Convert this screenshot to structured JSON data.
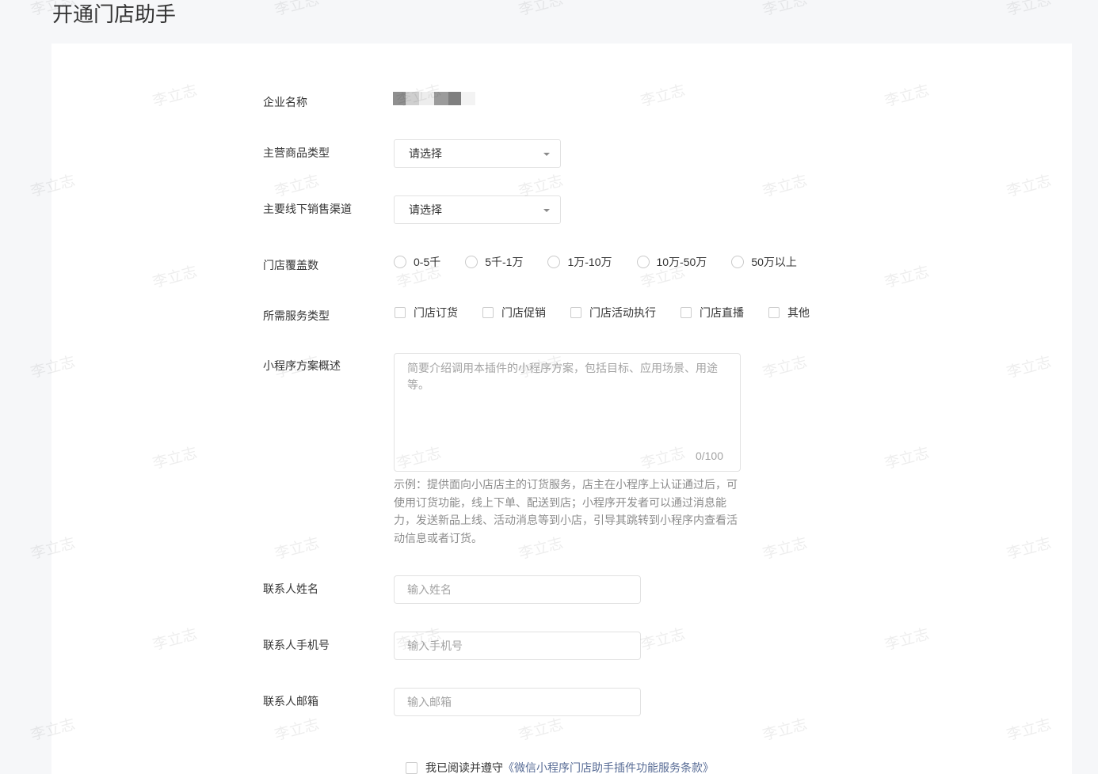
{
  "page": {
    "title": "开通门店助手"
  },
  "watermark": {
    "text": "李立志"
  },
  "icons": {
    "select_caret": "caret-down-icon"
  },
  "colors": {
    "page_background": "#f6f7f9",
    "card_background": "#ffffff",
    "text": "#353535",
    "link": "#576b95",
    "hint": "#8c8c8c"
  },
  "form": {
    "company_name": {
      "label": "企业名称"
    },
    "product_type": {
      "label": "主营商品类型",
      "display_value": "请选择"
    },
    "sales_channel": {
      "label": "主要线下销售渠道",
      "display_value": "请选择"
    },
    "store_coverage": {
      "label": "门店覆盖数",
      "options": [
        "0-5千",
        "5千-1万",
        "1万-10万",
        "10万-50万",
        "50万以上"
      ],
      "selected": null
    },
    "service_types": {
      "label": "所需服务类型",
      "options": [
        "门店订货",
        "门店促销",
        "门店活动执行",
        "门店直播",
        "其他"
      ],
      "checked": [
        false,
        false,
        false,
        false,
        false
      ]
    },
    "solution_summary": {
      "label": "小程序方案概述",
      "value": "",
      "placeholder": "简要介绍调用本插件的小程序方案，包括目标、应用场景、用途等。",
      "counter": "0/100",
      "example": "示例：提供面向小店店主的订货服务，店主在小程序上认证通过后，可使用订货功能，线上下单、配送到店；小程序开发者可以通过消息能力，发送新品上线、活动消息等到小店，引导其跳转到小程序内查看活动信息或者订货。"
    },
    "contact_name": {
      "label": "联系人姓名",
      "value": "",
      "placeholder": "输入姓名"
    },
    "contact_phone": {
      "label": "联系人手机号",
      "value": "",
      "placeholder": "输入手机号"
    },
    "contact_email": {
      "label": "联系人邮箱",
      "value": "",
      "placeholder": "输入邮箱"
    }
  },
  "agreement": {
    "checked": false,
    "text": "我已阅读并遵守",
    "link_text": "《微信小程序门店助手插件功能服务条款》"
  }
}
